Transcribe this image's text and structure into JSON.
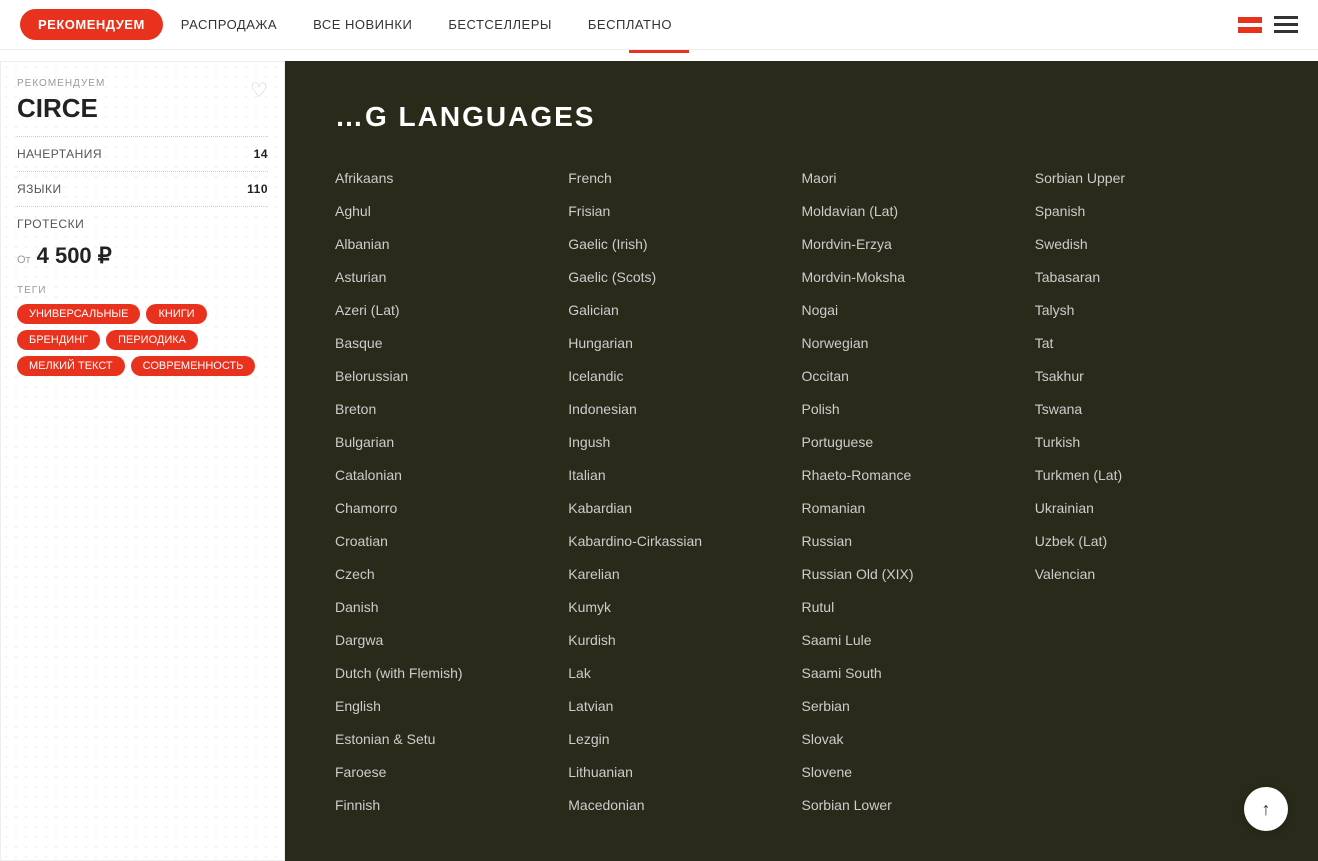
{
  "nav": {
    "featured_label": "РЕКОМЕНДУЕМ",
    "sale_label": "РАСПРОДАЖА",
    "new_label": "ВСЕ НОВИНКИ",
    "bestsellers_label": "БЕСТСЕЛЛЕРЫ",
    "free_label": "БЕСПЛАТНО"
  },
  "card": {
    "label": "РЕКОМЕНДУЕМ",
    "title": "CIRCE",
    "specs_label_1": "НАЧЕРТАНИЯ",
    "specs_value_1": "14",
    "specs_label_2": "ЯЗЫКИ",
    "specs_value_2": "110",
    "specs_label_3": "ГРОТЕСКИ",
    "price_from": "От",
    "price": "4 500 ₽",
    "tags_label": "ТЕГИ",
    "tags": [
      "УНИВЕРСАЛЬНЫЕ",
      "КНИГИ",
      "БРЕНДИНГ",
      "ПЕРИОДИКА",
      "МЕЛКИЙ ТЕКСТ",
      "СОВРЕМЕННОСТЬ"
    ]
  },
  "section": {
    "title": "G LANGUAGES",
    "accent": true
  },
  "languages": {
    "col1": [
      "Afrikaans",
      "Aghul",
      "Albanian",
      "Asturian",
      "Azeri (Lat)",
      "Basque",
      "Belorussian",
      "Breton",
      "Bulgarian",
      "Catalonian",
      "Chamorro",
      "Croatian",
      "Czech",
      "Danish",
      "Dargwa",
      "Dutch (with Flemish)",
      "English",
      "Estonian & Setu",
      "Faroese",
      "Finnish"
    ],
    "col2": [
      "French",
      "Frisian",
      "Gaelic (Irish)",
      "Gaelic (Scots)",
      "Galician",
      "Hungarian",
      "Icelandic",
      "Indonesian",
      "Ingush",
      "Italian",
      "Kabardian",
      "Kabardino-Cirkassian",
      "Karelian",
      "Kumyk",
      "Kurdish",
      "Lak",
      "Latvian",
      "Lezgin",
      "Lithuanian",
      "Macedonian"
    ],
    "col3": [
      "Maori",
      "Moldavian (Lat)",
      "Mordvin-Erzya",
      "Mordvin-Moksha",
      "Nogai",
      "Norwegian",
      "Occitan",
      "Polish",
      "Portuguese",
      "Rhaeto-Romance",
      "Romanian",
      "Russian",
      "Russian Old (XIX)",
      "Rutul",
      "Saami Lule",
      "Saami South",
      "Serbian",
      "Slovak",
      "Slovene",
      "Sorbian Lower"
    ],
    "col4": [
      "Sorbian Upper",
      "Spanish",
      "Swedish",
      "Tabasaran",
      "Talysh",
      "Tat",
      "Tsakhur",
      "Tswana",
      "Turkish",
      "Turkmen (Lat)",
      "Ukrainian",
      "Uzbek (Lat)",
      "Valencian"
    ]
  },
  "scroll_up_icon": "↑"
}
